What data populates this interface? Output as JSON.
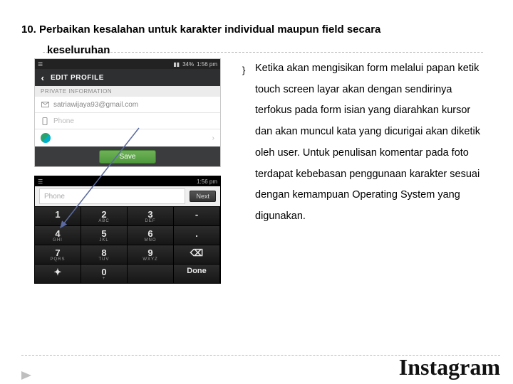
{
  "heading": {
    "line1": "10. Perbaikan kesalahan untuk karakter individual maupun field secara",
    "line2": "keseluruhan"
  },
  "paragraph": "Ketika akan mengisikan form melalui papan ketik touch screen layar akan dengan sendirinya terfokus pada form isian yang diarahkan kursor dan akan muncul kata yang dicurigai akan diketik oleh user. Untuk penulisan komentar pada foto terdapat kebebasan penggunaan karakter sesuai dengan kemampuan Operating System yang digunakan.",
  "phone1": {
    "status_left": "☰",
    "status_signal": "▮▮",
    "status_batt": "34%",
    "status_time": "1:56 pm",
    "back": "‹",
    "title": "EDIT PROFILE",
    "section": "PRIVATE INFORMATION",
    "email": "satriawijaya93@gmail.com",
    "phone_placeholder": "Phone",
    "gender_chevron": "›",
    "save": "Save"
  },
  "phone2": {
    "status_left": "☰",
    "status_time": "1:56 pm",
    "field_placeholder": "Phone",
    "next": "Next",
    "keys": {
      "r1": [
        {
          "d": "1",
          "l": ""
        },
        {
          "d": "2",
          "l": "ABC"
        },
        {
          "d": "3",
          "l": "DEF"
        },
        {
          "d": "-",
          "l": ""
        }
      ],
      "r2": [
        {
          "d": "4",
          "l": "GHI"
        },
        {
          "d": "5",
          "l": "JKL"
        },
        {
          "d": "6",
          "l": "MNO"
        },
        {
          "d": ".",
          "l": ""
        }
      ],
      "r3": [
        {
          "d": "7",
          "l": "PQRS"
        },
        {
          "d": "8",
          "l": "TUV"
        },
        {
          "d": "9",
          "l": "WXYZ"
        },
        {
          "d": "⌫",
          "l": ""
        }
      ],
      "r4": [
        {
          "d": "✦",
          "l": ""
        },
        {
          "d": "0",
          "l": "+"
        },
        {
          "d": "",
          "l": ""
        },
        {
          "d": "Done",
          "l": ""
        }
      ]
    }
  },
  "brand": "Instagram"
}
